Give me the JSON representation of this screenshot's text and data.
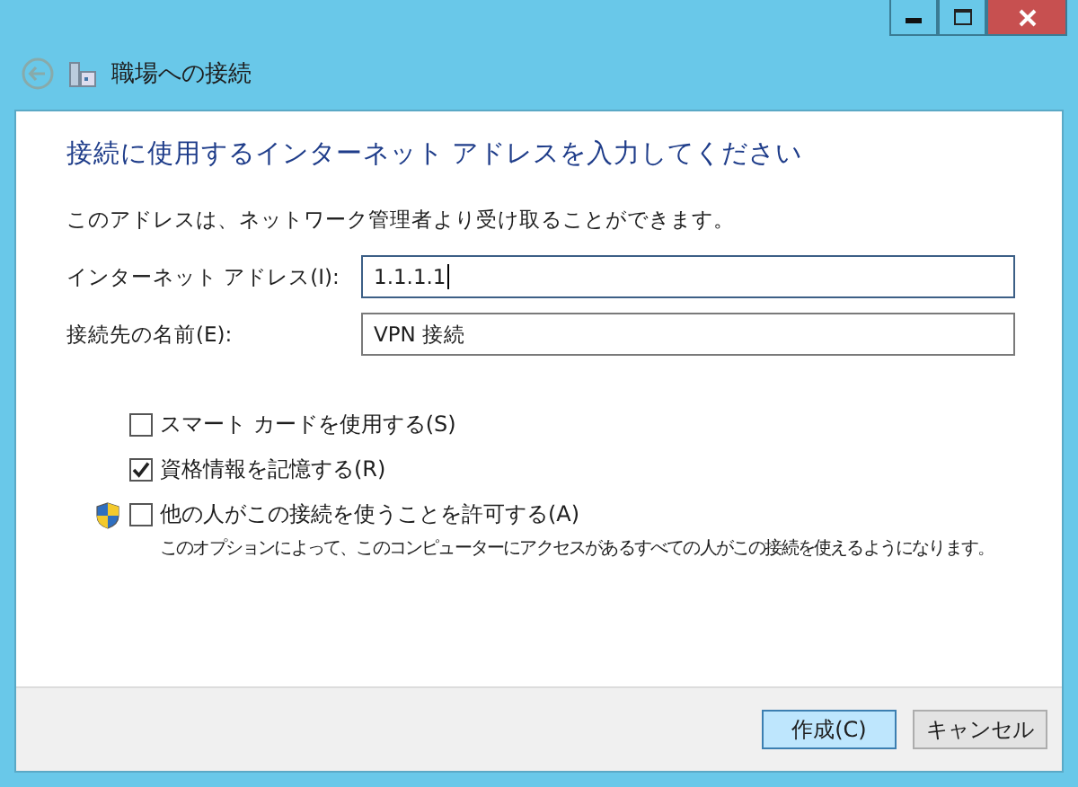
{
  "window": {
    "title": "職場への接続"
  },
  "heading": "接続に使用するインターネット アドレスを入力してください",
  "intro": "このアドレスは、ネットワーク管理者より受け取ることができます。",
  "fields": [
    {
      "label": "インターネット アドレス(I):",
      "value": "1.1.1.1",
      "focused": true
    },
    {
      "label": "接続先の名前(E):",
      "value": "VPN 接続",
      "focused": false
    }
  ],
  "options": [
    {
      "label": "スマート カードを使用する(S)",
      "checked": false,
      "shield": false
    },
    {
      "label": "資格情報を記憶する(R)",
      "checked": true,
      "shield": false
    },
    {
      "label": "他の人がこの接続を使うことを許可する(A)",
      "checked": false,
      "shield": true,
      "note": "このオプションによって、このコンピューターにアクセスがあるすべての人がこの接続を使えるようになります。"
    }
  ],
  "buttons": [
    {
      "label": "作成(C)",
      "default": true
    },
    {
      "label": "キャンセル",
      "default": false
    }
  ]
}
